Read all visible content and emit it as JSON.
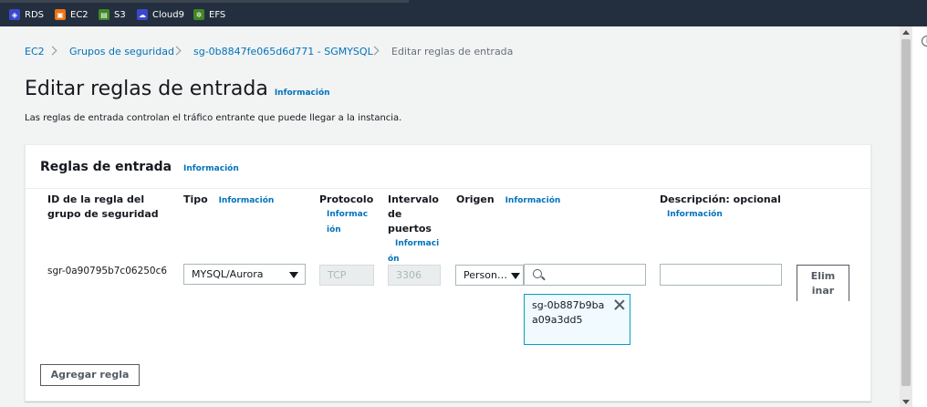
{
  "topbar": {
    "services": [
      {
        "label": "RDS",
        "icon": "rds-icon",
        "color": "#3b48cc"
      },
      {
        "label": "EC2",
        "icon": "ec2-icon",
        "color": "#ec7211"
      },
      {
        "label": "S3",
        "icon": "s3-icon",
        "color": "#3f8624"
      },
      {
        "label": "Cloud9",
        "icon": "cloud9-icon",
        "color": "#3b48cc"
      },
      {
        "label": "EFS",
        "icon": "efs-icon",
        "color": "#3f8624"
      }
    ]
  },
  "breadcrumb": {
    "items": [
      "EC2",
      "Grupos de seguridad",
      "sg-0b8847fe065d6d771 - SGMYSQL",
      "Editar reglas de entrada"
    ]
  },
  "page": {
    "title": "Editar reglas de entrada",
    "info": "Información",
    "description": "Las reglas de entrada controlan el tráfico entrante que puede llegar a la instancia."
  },
  "panel": {
    "title": "Reglas de entrada",
    "info": "Información",
    "columns": {
      "rule_id": "ID de la regla del grupo de seguridad",
      "type": "Tipo",
      "type_info": "Información",
      "protocol": "Protocolo",
      "protocol_info": "Información",
      "port_range": "Intervalo de puertos",
      "port_info": "Información",
      "source": "Origen",
      "source_info": "Información",
      "description": "Descripción: opcional",
      "description_info": "Información"
    },
    "rule": {
      "id": "sgr-0a90795b7c06250c6",
      "type": "MYSQL/Aurora",
      "protocol": "TCP",
      "port": "3306",
      "source_type": "Person…",
      "source_search": "",
      "source_token": "sg-0b887b9baa09a3dd5",
      "description": "",
      "delete_label": "Eliminar"
    },
    "add_rule_label": "Agregar regla"
  },
  "colors": {
    "link": "#0073bb",
    "header_bg": "#232f3e",
    "token_border": "#00a1c9"
  }
}
